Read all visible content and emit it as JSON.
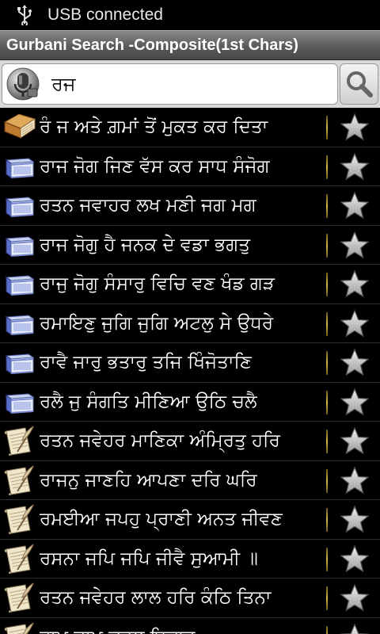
{
  "status_bar": {
    "text": "USB connected",
    "icon": "usb-icon"
  },
  "title_bar": {
    "title": "Gurbani Search -Composite(1st Chars)"
  },
  "search": {
    "query": "ਰਜ",
    "mic_icon": "mic-icon",
    "button_icon": "magnifier-icon"
  },
  "colors": {
    "background": "#000000",
    "title_bar": "#6a6a6a",
    "search_bg": "#d9d9d9",
    "divider": "#d6b54a"
  },
  "results": [
    {
      "text": "ਰੰ ਜ ਅਤੇ ਗ਼ਮਾਂ ਤੋਂ ਮੁਕਤ ਕਰ ਦਿਤਾ",
      "icon": "brown-book-icon"
    },
    {
      "text": "ਰਾਜ ਜੋਗ ਜਿਣ ਵੱਸ ਕਰ ਸਾਧ ਸੰਜੋਗ",
      "icon": "blue-book-icon"
    },
    {
      "text": "ਰਤਨ ਜਵਾਹਰ ਲਖ ਮਣੀ ਜਗ ਮਗ",
      "icon": "blue-book-icon"
    },
    {
      "text": "ਰਾਜ ਜੋਗੁ ਹੈ ਜਨਕ ਦੇ ਵਡਾ ਭਗਤੁ",
      "icon": "blue-book-icon"
    },
    {
      "text": "ਰਾਜੁ ਜੋਗੁ ਸੰਸਾਰੁ ਵਿਚਿ ਵਣ ਖੰਡ ਗੜ",
      "icon": "blue-book-icon"
    },
    {
      "text": "ਰਮਾਇਣੁ ਜੁਗਿ ਜੁਗਿ ਅਟਲੁ ਸੇ ਉਧਰੇ",
      "icon": "blue-book-icon"
    },
    {
      "text": "ਰਾਵੈ ਜਾਰੁ ਭਤਾਰੁ ਤਜਿ ਖਿੰਜੋਤਾਣਿ",
      "icon": "blue-book-icon"
    },
    {
      "text": "ਰਲੈ ਜੁ ਸੰਗਤਿ ਮੀਣਿਆ ਉਠਿ ਚਲੈ",
      "icon": "blue-book-icon"
    },
    {
      "text": "ਰਤਨ ਜਵੇਹਰ ਮਾਣਿਕਾ ਅੰਮ੍ਰਿਤੁ ਹਰਿ",
      "icon": "scroll-quill-icon"
    },
    {
      "text": "ਰਾਜਨੁ ਜਾਣਹਿ ਆਪਣਾ ਦਰਿ ਘਰਿ",
      "icon": "scroll-quill-icon"
    },
    {
      "text": "ਰਮਈਆ ਜਪਹੁ ਪ੍ਰਾਣੀ ਅਨਤ ਜੀਵਣ",
      "icon": "scroll-quill-icon"
    },
    {
      "text": "ਰਸਨਾ ਜਪਿ ਜਪਿ ਜੀਵੈ ਸੁਆਮੀ ॥",
      "icon": "scroll-quill-icon"
    },
    {
      "text": "ਰਤਨ ਜਵੇਹਰ ਲਾਲ ਹਰਿ ਕੰਠਿ ਤਿਨਾ",
      "icon": "scroll-quill-icon"
    },
    {
      "text": "ਰਾਮ ਜਾਪ ਕਵਲ ਇਕਾਰ",
      "icon": "scroll-quill-icon"
    }
  ]
}
